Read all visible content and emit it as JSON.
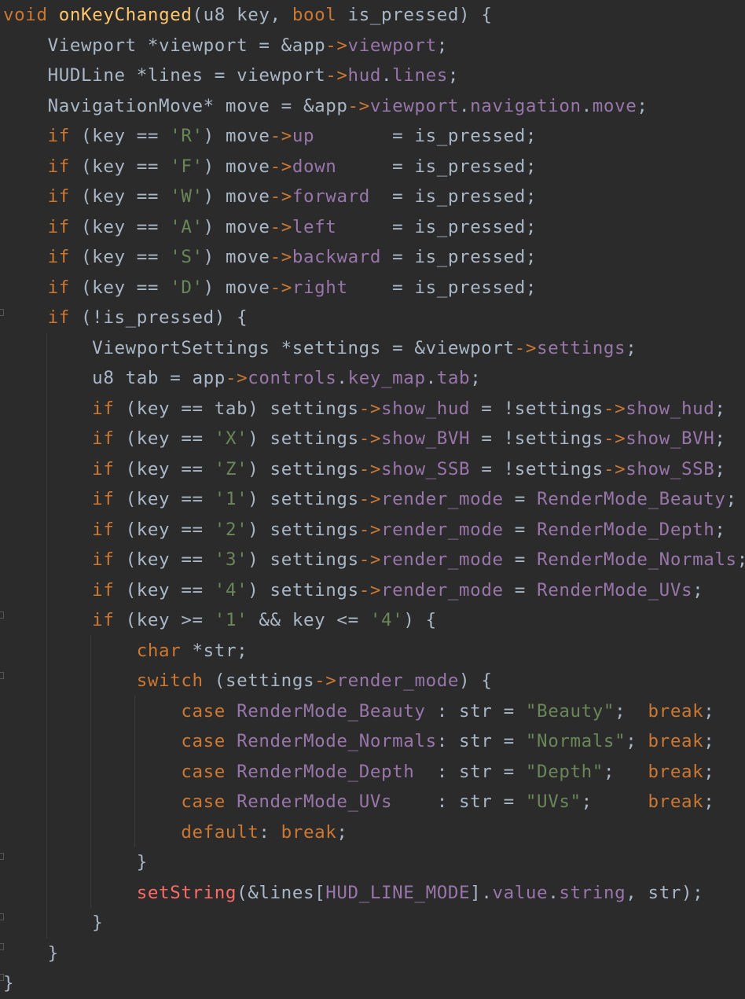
{
  "editor": {
    "language": "C",
    "theme_colors": {
      "background": "#2b2b2b",
      "default_text": "#a9b7c6",
      "keyword": "#cc7832",
      "function_declaration": "#ffc66d",
      "function_call": "#ff6b68",
      "field_member": "#9876aa",
      "string_literal": "#6a8759"
    },
    "lines": [
      "void onKeyChanged(u8 key, bool is_pressed) {",
      "    Viewport *viewport = &app->viewport;",
      "    HUDLine *lines = viewport->hud.lines;",
      "    NavigationMove* move = &app->viewport.navigation.move;",
      "    if (key == 'R') move->up       = is_pressed;",
      "    if (key == 'F') move->down     = is_pressed;",
      "    if (key == 'W') move->forward  = is_pressed;",
      "    if (key == 'A') move->left     = is_pressed;",
      "    if (key == 'S') move->backward = is_pressed;",
      "    if (key == 'D') move->right    = is_pressed;",
      "    if (!is_pressed) {",
      "        ViewportSettings *settings = &viewport->settings;",
      "        u8 tab = app->controls.key_map.tab;",
      "        if (key == tab) settings->show_hud = !settings->show_hud;",
      "        if (key == 'X') settings->show_BVH = !settings->show_BVH;",
      "        if (key == 'Z') settings->show_SSB = !settings->show_SSB;",
      "        if (key == '1') settings->render_mode = RenderMode_Beauty;",
      "        if (key == '2') settings->render_mode = RenderMode_Depth;",
      "        if (key == '3') settings->render_mode = RenderMode_Normals;",
      "        if (key == '4') settings->render_mode = RenderMode_UVs;",
      "        if (key >= '1' && key <= '4') {",
      "            char *str;",
      "            switch (settings->render_mode) {",
      "                case RenderMode_Beauty : str = \"Beauty\";  break;",
      "                case RenderMode_Normals: str = \"Normals\"; break;",
      "                case RenderMode_Depth  : str = \"Depth\";   break;",
      "                case RenderMode_UVs    : str = \"UVs\";     break;",
      "                default: break;",
      "            }",
      "            setString(&lines[HUD_LINE_MODE].value.string, str);",
      "        }",
      "    }",
      "}"
    ]
  }
}
